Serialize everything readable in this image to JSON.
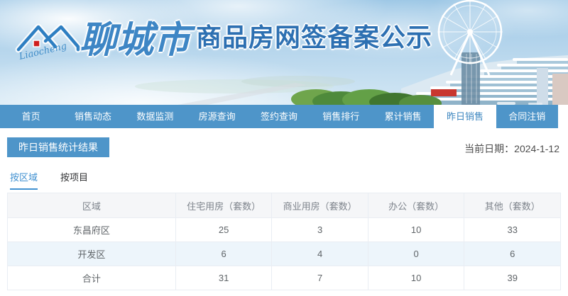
{
  "header": {
    "logo_script": "Liaocheng",
    "brand_calligraphy": "聊城市",
    "brand_title": "商品房网签备案公示"
  },
  "nav": {
    "items": [
      {
        "label": "首页",
        "active": false
      },
      {
        "label": "销售动态",
        "active": false
      },
      {
        "label": "数据监测",
        "active": false
      },
      {
        "label": "房源查询",
        "active": false
      },
      {
        "label": "签约查询",
        "active": false
      },
      {
        "label": "销售排行",
        "active": false
      },
      {
        "label": "累计销售",
        "active": false
      },
      {
        "label": "昨日销售",
        "active": true
      },
      {
        "label": "合同注销",
        "active": false
      }
    ]
  },
  "content": {
    "section_title": "昨日销售统计结果",
    "date_text": "当前日期：2024-1-12",
    "tabs": [
      {
        "label": "按区域",
        "active": true
      },
      {
        "label": "按项目",
        "active": false
      }
    ]
  },
  "table": {
    "headers": [
      "区域",
      "住宅用房（套数）",
      "商业用房（套数）",
      "办公（套数）",
      "其他（套数）"
    ],
    "rows": [
      {
        "region": "东昌府区",
        "values": [
          "25",
          "3",
          "10",
          "33"
        ]
      },
      {
        "region": "开发区",
        "values": [
          "6",
          "4",
          "0",
          "6"
        ]
      },
      {
        "region": "合计",
        "values": [
          "31",
          "7",
          "10",
          "39"
        ]
      }
    ]
  },
  "colors": {
    "nav_blue": "#4e95c9",
    "active_tab_text": "#3e87c0",
    "brand_blue": "#2d70b2",
    "stripe_row": "#edf5fb",
    "table_border": "#e9edf3",
    "logo_red": "#cf1d1d"
  }
}
